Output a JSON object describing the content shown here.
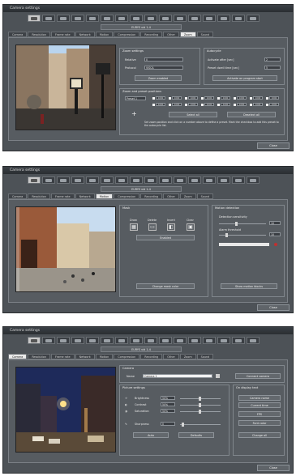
{
  "window_title": "Camera settings",
  "camera_buttons": [
    "CAM",
    "CAM",
    "CAM",
    "CAM",
    "CAM",
    "CAM",
    "CAM",
    "CAM",
    "CAM",
    "CAM",
    "CAM",
    "CAM",
    "CAM",
    "CAM",
    "CAM",
    "CAM"
  ],
  "camera_select": "EURYS vid 1-4",
  "tabs": [
    "Camera",
    "Resolution",
    "Frame rate",
    "Network",
    "Motion",
    "Compression",
    "Recording",
    "Other",
    "Zoom",
    "Sound"
  ],
  "close_label": "Close",
  "w1": {
    "zoom_settings": {
      "title": "Zoom settings",
      "rel_label": "Relative",
      "rel_value": "0",
      "prot_label": "Protocol",
      "prot_value": "VISCA",
      "zoom_btn": "Zoom enabled"
    },
    "autocycle": {
      "title": "Autocycle",
      "a1_label": "Activate after [sec]",
      "a1_value": "2",
      "a2_label": "Preset dwell time [sec]",
      "a2_value": "5",
      "btn": "Activate on program start"
    },
    "presets": {
      "title": "Zoom and preset positions",
      "preset_value": "Preset 1",
      "grid": [
        "1000",
        "1000",
        "1000",
        "1000",
        "1000",
        "1000",
        "1000",
        "1000",
        "1000",
        "1000",
        "1000",
        "1000",
        "1000",
        "1000",
        "1000",
        "1000"
      ],
      "plus": "+",
      "select_all": "Select all",
      "deselect_all": "Deselect all",
      "help": "Set zoom position and click on a number above to define a preset. Mark the checkbox to add this preset to the autocycle list."
    }
  },
  "w2": {
    "mask": {
      "title": "Mask",
      "tools": [
        "Draw",
        "Delete",
        "Invert",
        "Clear"
      ],
      "enabled": "Enabled",
      "change_color": "Change mask color"
    },
    "motion": {
      "title": "Motion detection",
      "sens_label": "Detection sensitivity",
      "sens_value": "10",
      "thresh_label": "Alarm threshold",
      "thresh_value": "10",
      "show": "Show motion blocks"
    }
  },
  "w3": {
    "camera": {
      "title": "Camera",
      "name_label": "Name",
      "name_value": "Camera 1",
      "connect": "Connect camera"
    },
    "picture": {
      "title": "Picture settings",
      "rows": [
        {
          "label": "Brightness",
          "value": "50%"
        },
        {
          "label": "Contrast",
          "value": "50%"
        },
        {
          "label": "Saturation",
          "value": "50%"
        },
        {
          "label": "Sharpness",
          "value": "0"
        }
      ],
      "auto": "Auto",
      "defaults": "Defaults"
    },
    "display": {
      "title": "On display text",
      "buttons": [
        "Camera name",
        "Current time",
        "FPS",
        "Font color",
        "Change all"
      ]
    }
  },
  "colors": {
    "window_bg": "#4d5257",
    "panel_bg": "#575c61",
    "active_tab": "#eaeaea"
  }
}
